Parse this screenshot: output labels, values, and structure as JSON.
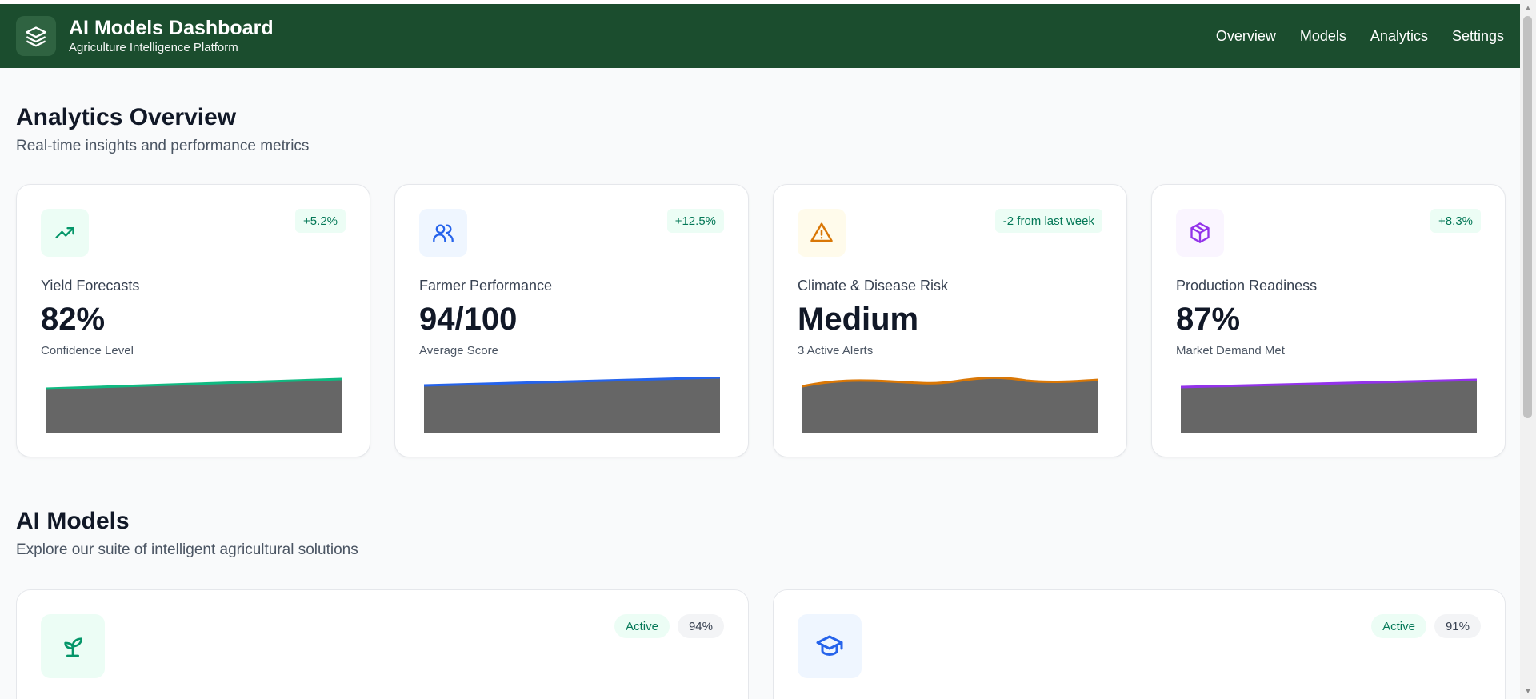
{
  "header": {
    "title": "AI Models Dashboard",
    "subtitle": "Agriculture Intelligence Platform",
    "logo_icon": "layers-icon",
    "nav": [
      "Overview",
      "Models",
      "Analytics",
      "Settings"
    ]
  },
  "analytics": {
    "title": "Analytics Overview",
    "subtitle": "Real-time insights and performance metrics",
    "cards": [
      {
        "icon": "trending-up-icon",
        "badge": "+5.2%",
        "label": "Yield Forecasts",
        "value": "82%",
        "caption": "Confidence Level",
        "color": "#10b981",
        "icon_bg": "#ecfdf5"
      },
      {
        "icon": "users-icon",
        "badge": "+12.5%",
        "label": "Farmer Performance",
        "value": "94/100",
        "caption": "Average Score",
        "color": "#2563eb",
        "icon_bg": "#eff6ff"
      },
      {
        "icon": "warning-icon",
        "badge": "-2 from last week",
        "label": "Climate & Disease Risk",
        "value": "Medium",
        "caption": "3 Active Alerts",
        "color": "#d97706",
        "icon_bg": "#fffbeb"
      },
      {
        "icon": "package-icon",
        "badge": "+8.3%",
        "label": "Production Readiness",
        "value": "87%",
        "caption": "Market Demand Met",
        "color": "#9333ea",
        "icon_bg": "#faf5ff"
      }
    ]
  },
  "models": {
    "title": "AI Models",
    "subtitle": "Explore our suite of intelligent agricultural solutions",
    "cards": [
      {
        "icon": "sprout-icon",
        "status": "Active",
        "score": "94%",
        "color": "#059669",
        "icon_bg": "#ecfdf5"
      },
      {
        "icon": "graduation-cap-icon",
        "status": "Active",
        "score": "91%",
        "color": "#2563eb",
        "icon_bg": "#eff6ff"
      }
    ]
  }
}
